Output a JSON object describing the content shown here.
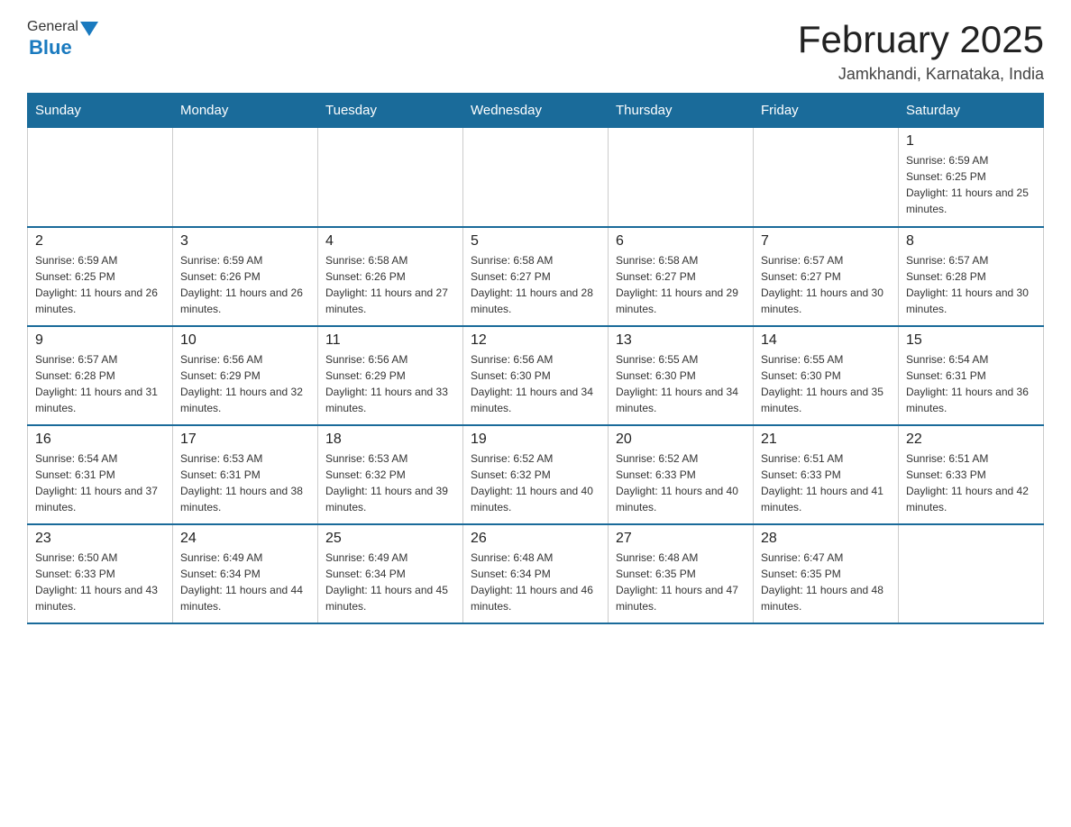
{
  "header": {
    "logo_general": "General",
    "logo_blue": "Blue",
    "month_title": "February 2025",
    "location": "Jamkhandi, Karnataka, India"
  },
  "days_of_week": [
    "Sunday",
    "Monday",
    "Tuesday",
    "Wednesday",
    "Thursday",
    "Friday",
    "Saturday"
  ],
  "weeks": [
    [
      {
        "day": "",
        "info": ""
      },
      {
        "day": "",
        "info": ""
      },
      {
        "day": "",
        "info": ""
      },
      {
        "day": "",
        "info": ""
      },
      {
        "day": "",
        "info": ""
      },
      {
        "day": "",
        "info": ""
      },
      {
        "day": "1",
        "info": "Sunrise: 6:59 AM\nSunset: 6:25 PM\nDaylight: 11 hours and 25 minutes."
      }
    ],
    [
      {
        "day": "2",
        "info": "Sunrise: 6:59 AM\nSunset: 6:25 PM\nDaylight: 11 hours and 26 minutes."
      },
      {
        "day": "3",
        "info": "Sunrise: 6:59 AM\nSunset: 6:26 PM\nDaylight: 11 hours and 26 minutes."
      },
      {
        "day": "4",
        "info": "Sunrise: 6:58 AM\nSunset: 6:26 PM\nDaylight: 11 hours and 27 minutes."
      },
      {
        "day": "5",
        "info": "Sunrise: 6:58 AM\nSunset: 6:27 PM\nDaylight: 11 hours and 28 minutes."
      },
      {
        "day": "6",
        "info": "Sunrise: 6:58 AM\nSunset: 6:27 PM\nDaylight: 11 hours and 29 minutes."
      },
      {
        "day": "7",
        "info": "Sunrise: 6:57 AM\nSunset: 6:27 PM\nDaylight: 11 hours and 30 minutes."
      },
      {
        "day": "8",
        "info": "Sunrise: 6:57 AM\nSunset: 6:28 PM\nDaylight: 11 hours and 30 minutes."
      }
    ],
    [
      {
        "day": "9",
        "info": "Sunrise: 6:57 AM\nSunset: 6:28 PM\nDaylight: 11 hours and 31 minutes."
      },
      {
        "day": "10",
        "info": "Sunrise: 6:56 AM\nSunset: 6:29 PM\nDaylight: 11 hours and 32 minutes."
      },
      {
        "day": "11",
        "info": "Sunrise: 6:56 AM\nSunset: 6:29 PM\nDaylight: 11 hours and 33 minutes."
      },
      {
        "day": "12",
        "info": "Sunrise: 6:56 AM\nSunset: 6:30 PM\nDaylight: 11 hours and 34 minutes."
      },
      {
        "day": "13",
        "info": "Sunrise: 6:55 AM\nSunset: 6:30 PM\nDaylight: 11 hours and 34 minutes."
      },
      {
        "day": "14",
        "info": "Sunrise: 6:55 AM\nSunset: 6:30 PM\nDaylight: 11 hours and 35 minutes."
      },
      {
        "day": "15",
        "info": "Sunrise: 6:54 AM\nSunset: 6:31 PM\nDaylight: 11 hours and 36 minutes."
      }
    ],
    [
      {
        "day": "16",
        "info": "Sunrise: 6:54 AM\nSunset: 6:31 PM\nDaylight: 11 hours and 37 minutes."
      },
      {
        "day": "17",
        "info": "Sunrise: 6:53 AM\nSunset: 6:31 PM\nDaylight: 11 hours and 38 minutes."
      },
      {
        "day": "18",
        "info": "Sunrise: 6:53 AM\nSunset: 6:32 PM\nDaylight: 11 hours and 39 minutes."
      },
      {
        "day": "19",
        "info": "Sunrise: 6:52 AM\nSunset: 6:32 PM\nDaylight: 11 hours and 40 minutes."
      },
      {
        "day": "20",
        "info": "Sunrise: 6:52 AM\nSunset: 6:33 PM\nDaylight: 11 hours and 40 minutes."
      },
      {
        "day": "21",
        "info": "Sunrise: 6:51 AM\nSunset: 6:33 PM\nDaylight: 11 hours and 41 minutes."
      },
      {
        "day": "22",
        "info": "Sunrise: 6:51 AM\nSunset: 6:33 PM\nDaylight: 11 hours and 42 minutes."
      }
    ],
    [
      {
        "day": "23",
        "info": "Sunrise: 6:50 AM\nSunset: 6:33 PM\nDaylight: 11 hours and 43 minutes."
      },
      {
        "day": "24",
        "info": "Sunrise: 6:49 AM\nSunset: 6:34 PM\nDaylight: 11 hours and 44 minutes."
      },
      {
        "day": "25",
        "info": "Sunrise: 6:49 AM\nSunset: 6:34 PM\nDaylight: 11 hours and 45 minutes."
      },
      {
        "day": "26",
        "info": "Sunrise: 6:48 AM\nSunset: 6:34 PM\nDaylight: 11 hours and 46 minutes."
      },
      {
        "day": "27",
        "info": "Sunrise: 6:48 AM\nSunset: 6:35 PM\nDaylight: 11 hours and 47 minutes."
      },
      {
        "day": "28",
        "info": "Sunrise: 6:47 AM\nSunset: 6:35 PM\nDaylight: 11 hours and 48 minutes."
      },
      {
        "day": "",
        "info": ""
      }
    ]
  ]
}
